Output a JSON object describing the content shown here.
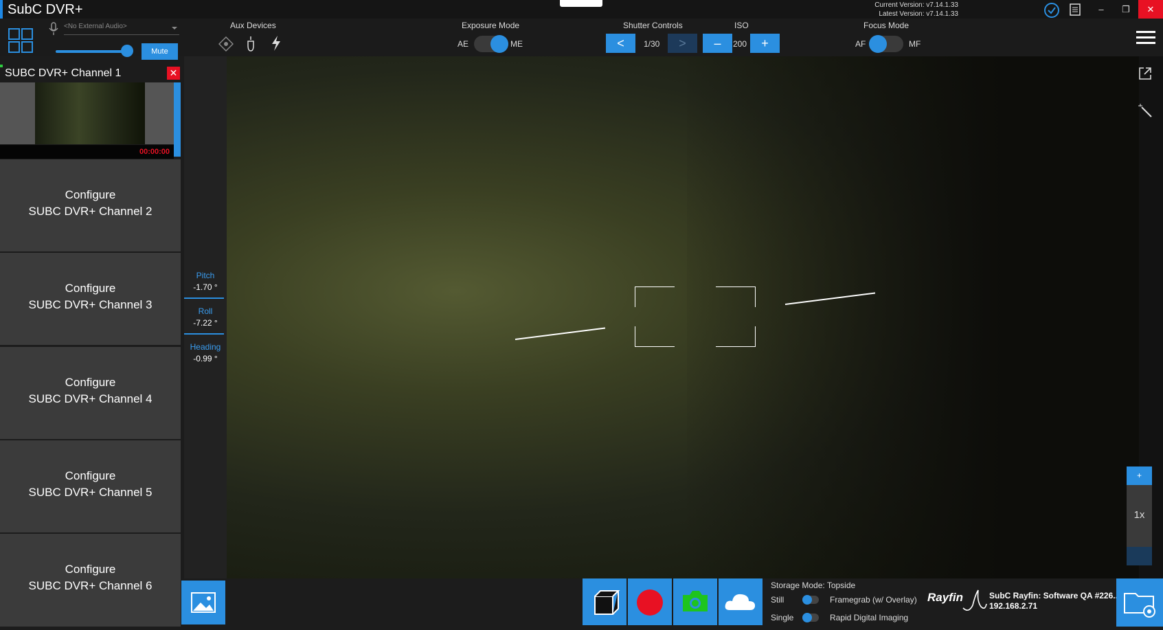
{
  "titlebar": {
    "title": "SubC DVR+",
    "current_version": "Current Version: v7.14.1.33",
    "latest_version": "Latest Version: v7.14.1.33",
    "minimize": "–",
    "restore": "❐",
    "close": "✕"
  },
  "toolbar": {
    "audio_placeholder": "<No External Audio>",
    "mute_label": "Mute",
    "aux_label": "Aux Devices",
    "exposure_label": "Exposure Mode",
    "exposure_left": "AE",
    "exposure_right": "ME",
    "shutter_label": "Shutter Controls",
    "shutter_prev": "<",
    "shutter_value": "1/30",
    "shutter_next": ">",
    "iso_label": "ISO",
    "iso_minus": "–",
    "iso_value": "200",
    "iso_plus": "+",
    "focus_label": "Focus Mode",
    "focus_left": "AF",
    "focus_right": "MF",
    "volume_level": 0.95
  },
  "channels": {
    "active": {
      "title": "SUBC DVR+ Channel 1",
      "close": "✕",
      "timecode": "00:00:00"
    },
    "configure": [
      {
        "line1": "Configure",
        "line2": "SUBC DVR+ Channel 2"
      },
      {
        "line1": "Configure",
        "line2": "SUBC DVR+ Channel 3"
      },
      {
        "line1": "Configure",
        "line2": "SUBC DVR+ Channel 4"
      },
      {
        "line1": "Configure",
        "line2": "SUBC DVR+ Channel 5"
      },
      {
        "line1": "Configure",
        "line2": "SUBC DVR+ Channel 6"
      }
    ]
  },
  "attitude": {
    "pitch_label": "Pitch",
    "pitch_value": "-1.70 °",
    "roll_label": "Roll",
    "roll_value": "-7.22 °",
    "heading_label": "Heading",
    "heading_value": "-0.99 °"
  },
  "zoom": {
    "plus": "+",
    "value": "1x"
  },
  "storage": {
    "mode": "Storage Mode: Topside",
    "still": "Still",
    "framegrab": "Framegrab (w/ Overlay)",
    "single": "Single",
    "rapid": "Rapid Digital Imaging"
  },
  "device": {
    "logo": "Rayfin",
    "name": "SubC Rayfin: Software QA #226...",
    "ip": "192.168.2.71"
  },
  "colors": {
    "accent": "#2b8fe0",
    "record": "#e81123",
    "camera": "#1ec41e"
  },
  "icons": [
    "grid-icon",
    "microphone-icon",
    "aux-device-icon",
    "lamp-icon",
    "flash-icon",
    "sync-icon",
    "notes-icon",
    "hamburger-icon",
    "popout-icon",
    "magic-wand-icon",
    "gallery-icon",
    "cube-icon",
    "record-icon",
    "camera-icon",
    "cloud-icon",
    "folder-settings-icon"
  ]
}
